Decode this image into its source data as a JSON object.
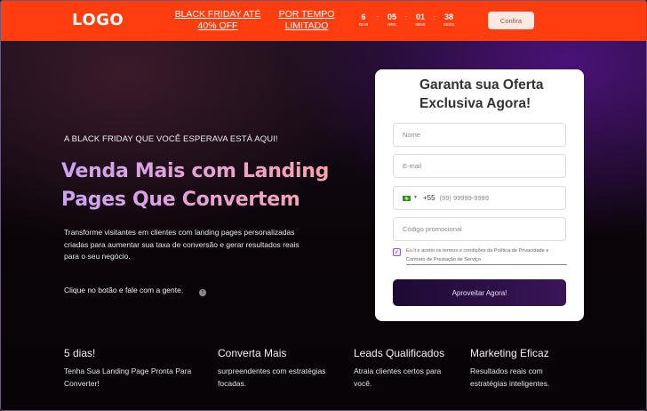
{
  "topbar": {
    "logo": "LOGO",
    "promo_black_friday": "BLACK FRIDAY ATÉ 40% OFF",
    "promo_limited": "POR TEMPO LIMITADO",
    "countdown": [
      {
        "value": "6",
        "label": "DIAS"
      },
      {
        "value": "05",
        "label": "HRS"
      },
      {
        "value": "01",
        "label": "MINS"
      },
      {
        "value": "38",
        "label": "SEGS"
      }
    ],
    "separator": ":",
    "confirm_label": "Confira"
  },
  "hero": {
    "kicker": "A BLACK FRIDAY QUE VOCÊ ESPERAVA ESTÁ AQUI!",
    "headline": "Venda Mais com Landing Pages Que Convertem",
    "description": "Transforme visitantes em clientes com landing pages personalizadas criadas para aumentar sua taxa de conversão e gerar resultados reais para o seu negócio.",
    "cta_text": "Clique no botão  e fale com a gente.",
    "info_icon_glyph": "!"
  },
  "form": {
    "title": "Garanta sua Oferta Exclusiva Agora!",
    "name_placeholder": "Nome",
    "email_placeholder": "E-mail",
    "phone_dial_code": "+55",
    "phone_placeholder": "(99) 99999-9999",
    "promo_placeholder": "Código promocional",
    "consent_checked": true,
    "consent_text": "Eu li e aceito os termos e condições da Política de Privacidade e Contrato de Prestação de Serviço",
    "submit_label": "Aproveitar Agora!"
  },
  "features": [
    {
      "title": "5 dias!",
      "text": "Tenha Sua Landing Page Pronta Para Converter!"
    },
    {
      "title": "Converta Mais",
      "text": "surpreendentes com estratégias focadas."
    },
    {
      "title": "Leads Qualificados",
      "text": "Atraia clientes certos para você."
    },
    {
      "title": "Marketing Eficaz",
      "text": "Resultados reais com estratégias inteligentes."
    }
  ],
  "colors": {
    "topbar": "#ff3d0f",
    "button_dark": "#1d0a33",
    "headline_gradient_start": "#c9a4f2",
    "headline_gradient_end": "#ffa3a6"
  }
}
